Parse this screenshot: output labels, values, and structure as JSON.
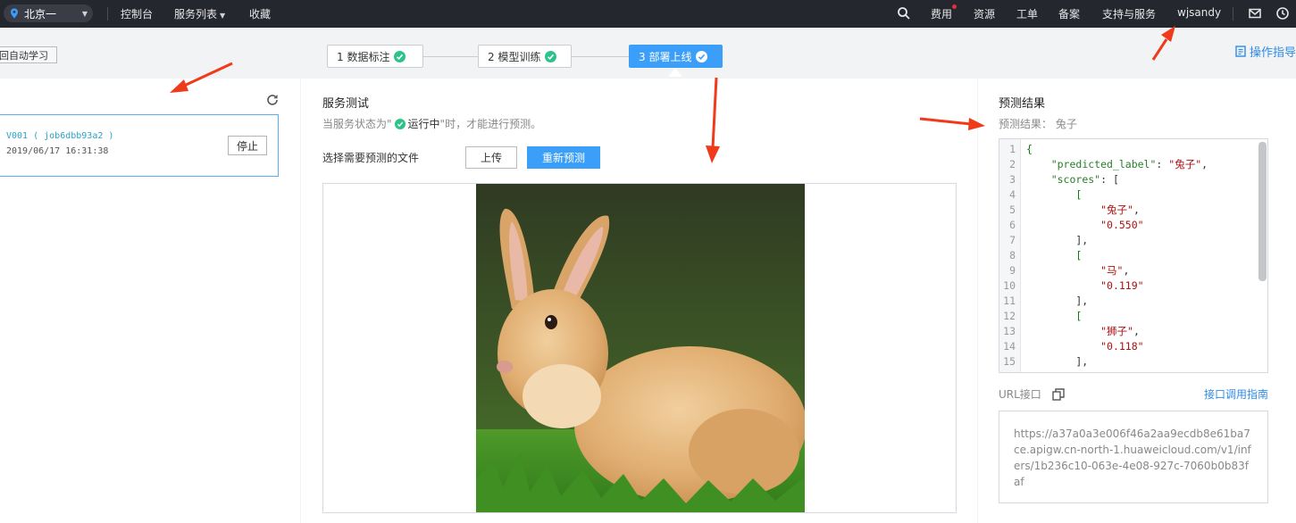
{
  "topbar": {
    "region": "北京一",
    "nav": [
      "控制台",
      "服务列表",
      "收藏"
    ],
    "right_links": [
      "费用",
      "资源",
      "工单",
      "备案",
      "支持与服务"
    ],
    "username": "wjsandy"
  },
  "steps": {
    "back_label": "回自动学习",
    "items": [
      "1 数据标注",
      "2 模型训练",
      "3 部署上线"
    ],
    "guide_label": "操作指导"
  },
  "jobs": {
    "card": {
      "name": "V001 ( job6dbb93a2 )",
      "time": "2019/06/17 16:31:38",
      "stop_label": "停止"
    }
  },
  "service_test": {
    "title": "服务测试",
    "status_prefix": "当服务状态为\"",
    "status_value": "运行中",
    "status_suffix": "\"时，才能进行预测。",
    "file_label": "选择需要预测的文件",
    "upload_label": "上传",
    "repredict_label": "重新预测"
  },
  "prediction": {
    "title": "预测结果",
    "summary": "预测结果：  兔子",
    "code_lines": [
      {
        "n": "1",
        "t": "{"
      },
      {
        "n": "2",
        "t": "    \"predicted_label\": \"兔子\","
      },
      {
        "n": "3",
        "t": "    \"scores\": ["
      },
      {
        "n": "4",
        "t": "        ["
      },
      {
        "n": "5",
        "t": "            \"兔子\","
      },
      {
        "n": "6",
        "t": "            \"0.550\""
      },
      {
        "n": "7",
        "t": "        ],"
      },
      {
        "n": "8",
        "t": "        ["
      },
      {
        "n": "9",
        "t": "            \"马\","
      },
      {
        "n": "10",
        "t": "            \"0.119\""
      },
      {
        "n": "11",
        "t": "        ],"
      },
      {
        "n": "12",
        "t": "        ["
      },
      {
        "n": "13",
        "t": "            \"狮子\","
      },
      {
        "n": "14",
        "t": "            \"0.118\""
      },
      {
        "n": "15",
        "t": "        ],"
      }
    ],
    "url_label": "URL接口",
    "api_guide_label": "接口调用指南",
    "url": "https://a37a0a3e006f46a2aa9ecdb8e61ba7ce.apigw.cn-north-1.huaweicloud.com/v1/infers/1b236c10-063e-4e08-927c-7060b0b83faf"
  },
  "colors": {
    "topbar_bg": "#25272e",
    "accent": "#3b9ef8",
    "success": "#2ec28b",
    "annotation_arrow": "#f03a1c"
  }
}
